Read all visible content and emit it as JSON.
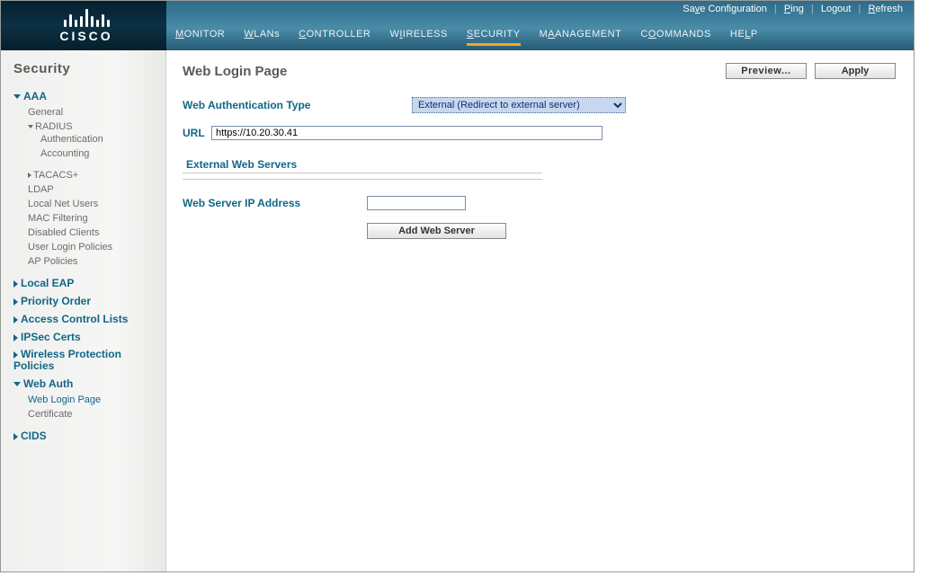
{
  "brand": "CISCO",
  "top_links": {
    "save": "Save Configuration",
    "ping": "Ping",
    "logout": "Logout",
    "refresh": "Refresh"
  },
  "main_nav": {
    "monitor": "ONITOR",
    "wlans": "LANs",
    "controller": "ONTROLLER",
    "wireless": "IRELESS",
    "security": "ECURITY",
    "management": "ANAGEMENT",
    "commands": "OMMANDS",
    "help": "ELP"
  },
  "sidebar": {
    "title": "Security",
    "aaa": {
      "label": "AAA",
      "general": "General",
      "radius": {
        "label": "RADIUS",
        "auth": "Authentication",
        "acct": "Accounting"
      },
      "tacacs": "TACACS+",
      "ldap": "LDAP",
      "local_net": "Local Net Users",
      "mac": "MAC Filtering",
      "disabled": "Disabled Clients",
      "userlogin": "User Login Policies",
      "ap": "AP Policies"
    },
    "local_eap": "Local EAP",
    "priority": "Priority Order",
    "acl": "Access Control Lists",
    "ipsec": "IPSec Certs",
    "wpp": "Wireless Protection Policies",
    "webauth": {
      "label": "Web Auth",
      "login": "Web Login Page",
      "cert": "Certificate"
    },
    "cids": "CIDS"
  },
  "page": {
    "title": "Web Login Page",
    "preview_btn": "Preview...",
    "apply_btn": "Apply"
  },
  "form": {
    "auth_type_label": "Web Authentication Type",
    "auth_type_value": "External (Redirect to external server)",
    "url_label": "URL",
    "url_value": "https://10.20.30.41",
    "ext_servers_title": "External Web Servers",
    "ip_label": "Web Server IP Address",
    "ip_value": "",
    "add_btn": "Add Web Server"
  },
  "image_id": "221887"
}
